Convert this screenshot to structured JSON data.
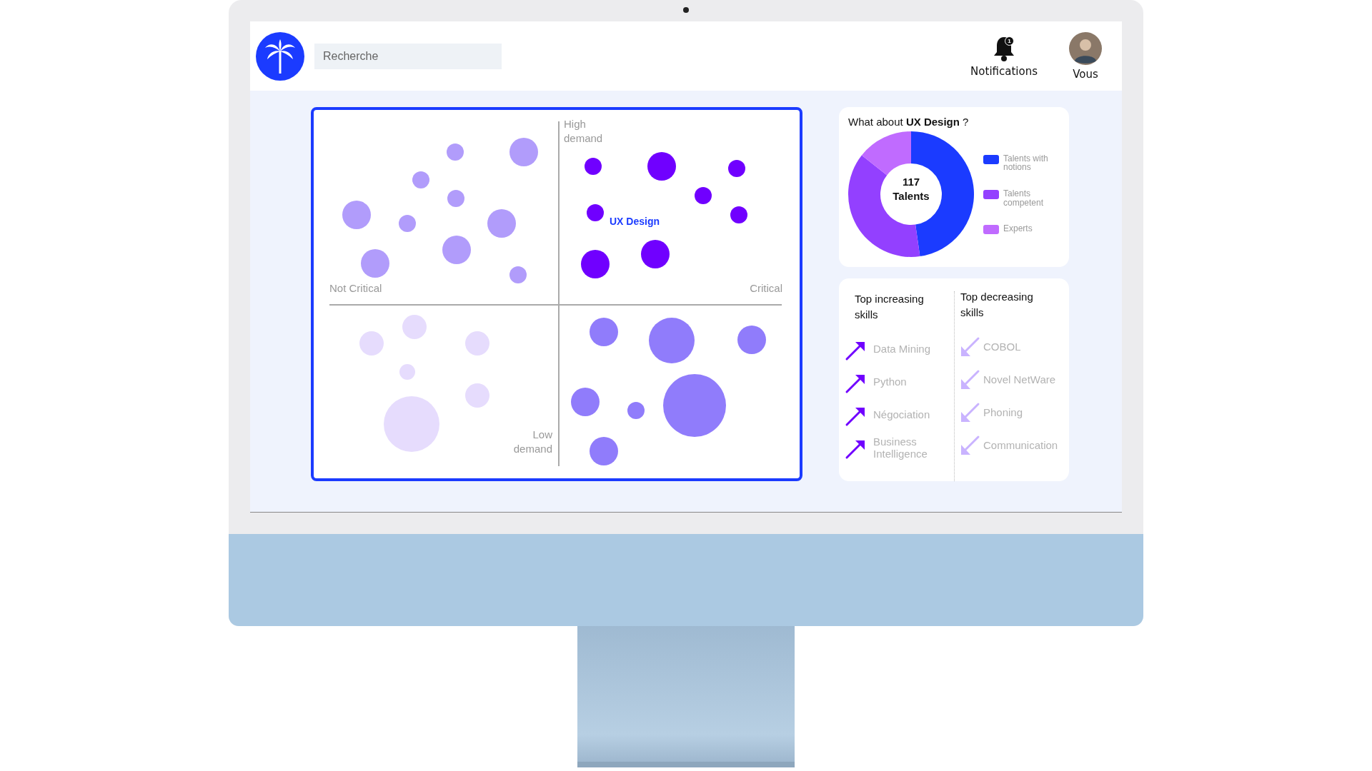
{
  "header": {
    "search": {
      "placeholder": "Recherche"
    },
    "notifications": {
      "label": "Notifications",
      "badge": "1"
    },
    "profile": {
      "label": "Vous"
    }
  },
  "matrix": {
    "high": "High demand",
    "low": "Low demand",
    "left": "Not Critical",
    "right": "Critical",
    "highlight": "UX Design",
    "quadrants": [
      {
        "color": "#b19cfb"
      },
      {
        "color": "#7000ff"
      },
      {
        "color": "#e6dcfd"
      },
      {
        "color": "#907cfb"
      }
    ]
  },
  "talents": {
    "title": "What about **UX Design** ?",
    "total": "117",
    "unit": "Talents",
    "legend": [
      {
        "label": "Talents with notions",
        "color": "#1b3bff"
      },
      {
        "label": "Talents competent",
        "color": "#9340ff"
      },
      {
        "label": "Experts",
        "color": "#c06bff"
      }
    ]
  },
  "skills": {
    "increasing": {
      "title": "Top increasing skills",
      "items": [
        "Data Mining",
        "Python",
        "Négociation",
        "Business Intelligence"
      ]
    },
    "decreasing": {
      "title": "Top decreasing skills",
      "items": [
        "COBOL",
        "Novel NetWare",
        "Phoning",
        "Communication"
      ]
    }
  }
}
